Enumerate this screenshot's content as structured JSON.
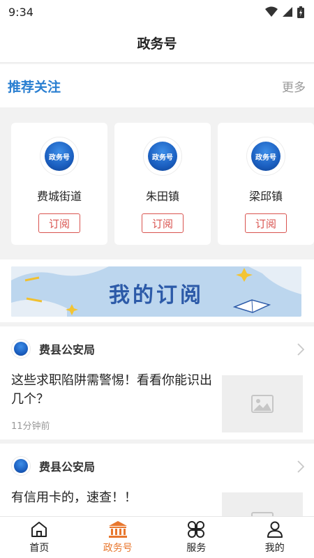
{
  "status": {
    "time": "9:34"
  },
  "header": {
    "title": "政务号"
  },
  "recommend": {
    "title": "推荐关注",
    "more_label": "更多",
    "cards": [
      {
        "name": "费城街道",
        "logo_text": "政务号",
        "button": "订阅"
      },
      {
        "name": "朱田镇",
        "logo_text": "政务号",
        "button": "订阅"
      },
      {
        "name": "梁邱镇",
        "logo_text": "政务号",
        "button": "订阅"
      }
    ]
  },
  "banner": {
    "text": "我的订阅"
  },
  "news": [
    {
      "source": "费县公安局",
      "title": "这些求职陷阱需警惕！看看你能识出几个？",
      "time": "11分钟前"
    },
    {
      "source": "费县公安局",
      "title": "有信用卡的，速查！！",
      "time": ""
    }
  ],
  "tabs": [
    {
      "label": "首页",
      "icon": "home-icon",
      "active": false
    },
    {
      "label": "政务号",
      "icon": "government-building-icon",
      "active": true
    },
    {
      "label": "服务",
      "icon": "services-grid-icon",
      "active": false
    },
    {
      "label": "我的",
      "icon": "profile-icon",
      "active": false
    }
  ],
  "colors": {
    "accent_blue": "#2a7fd1",
    "accent_orange": "#e8772e",
    "subscribe_red": "#d9534f"
  }
}
